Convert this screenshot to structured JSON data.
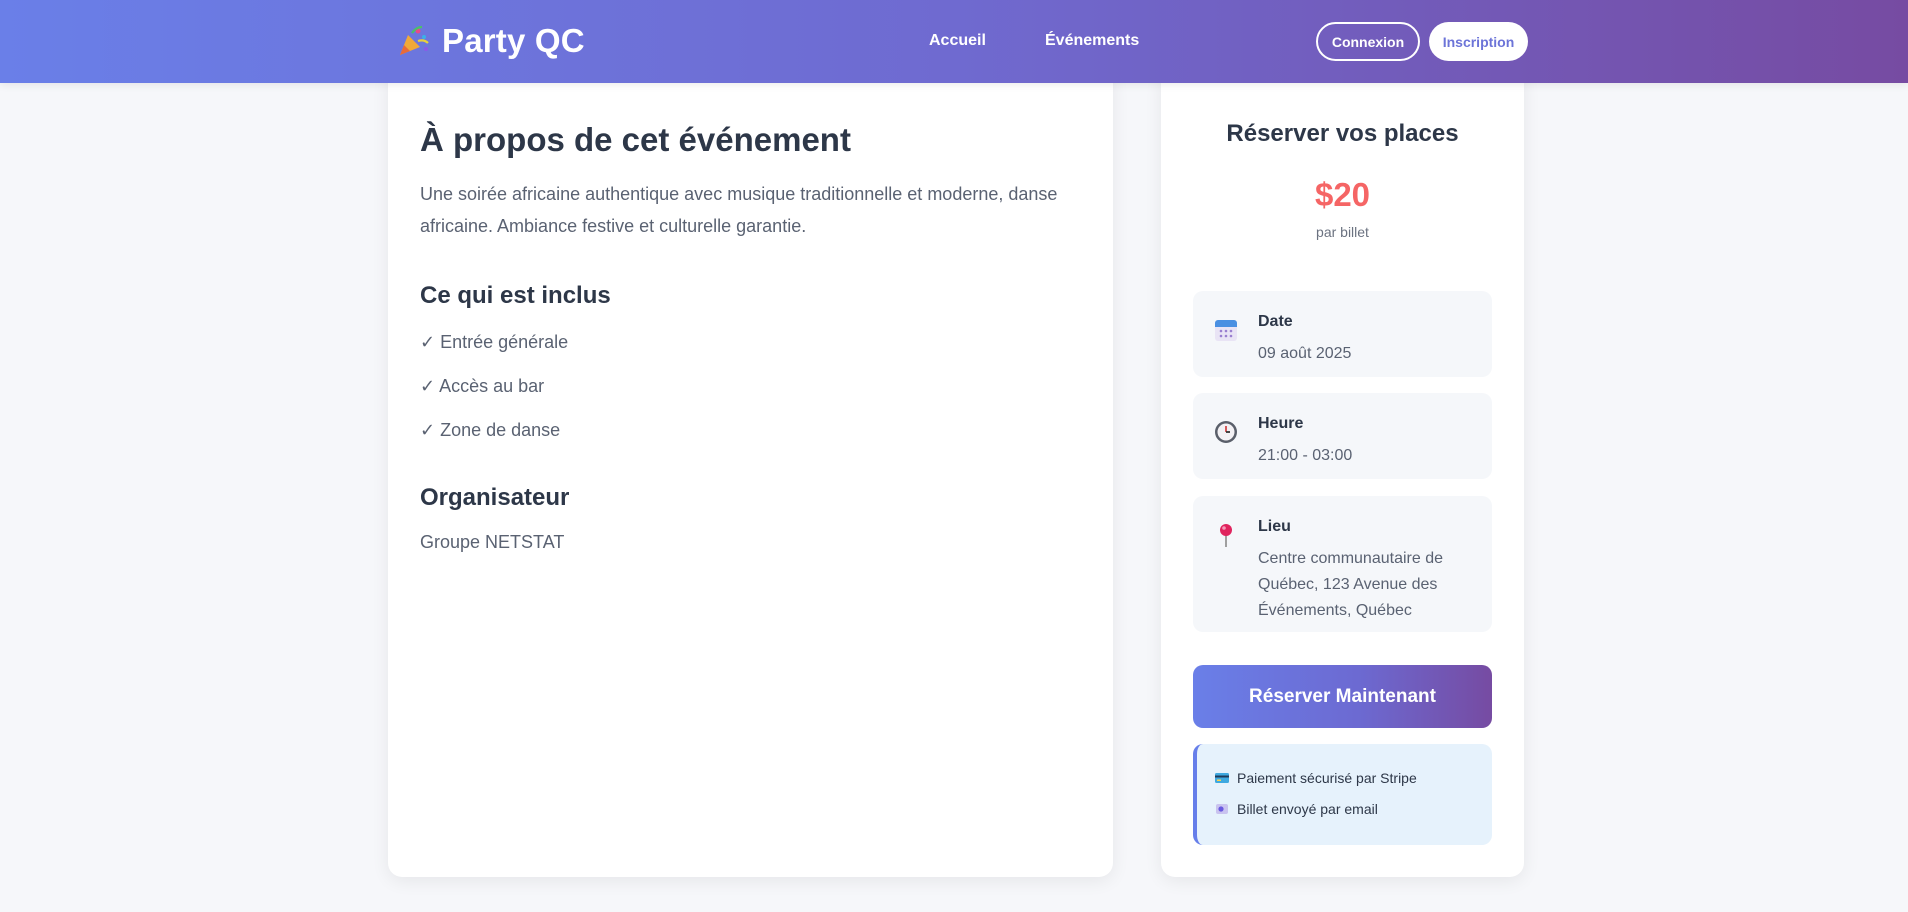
{
  "header": {
    "brand": "Party QC",
    "nav": [
      {
        "label": "Accueil"
      },
      {
        "label": "Événements"
      }
    ],
    "login_label": "Connexion",
    "signup_label": "Inscription"
  },
  "about": {
    "title": "À propos de cet événement",
    "description": "Une soirée africaine authentique avec musique traditionnelle et moderne, danse africaine. Ambiance festive et culturelle garantie.",
    "included_title": "Ce qui est inclus",
    "included": [
      "✓ Entrée générale",
      "✓ Accès au bar",
      "✓ Zone de danse"
    ],
    "organizer_title": "Organisateur",
    "organizer": "Groupe NETSTAT"
  },
  "booking": {
    "title": "Réserver vos places",
    "price": "$20",
    "price_note": "par billet",
    "date_label": "Date",
    "date_value": "09 août 2025",
    "time_label": "Heure",
    "time_value": "21:00 - 03:00",
    "place_label": "Lieu",
    "place_value": "Centre communautaire de Québec, 123 Avenue des Événements, Québec",
    "reserve_button": "Réserver Maintenant",
    "secure_lines": [
      "Paiement sécurisé par Stripe",
      "Billet envoyé par email"
    ]
  },
  "colors": {
    "header_gradient_start": "#667eea",
    "header_gradient_end": "#764ba2",
    "price": "#f56565",
    "info_bg": "#f5f7fa",
    "secure_bg": "#e6f2fc"
  },
  "icons": {
    "logo": "party-popper-icon",
    "date": "calendar-icon",
    "time": "clock-icon",
    "place": "pin-icon",
    "payment": "credit-card-icon",
    "email": "ticket-icon"
  }
}
